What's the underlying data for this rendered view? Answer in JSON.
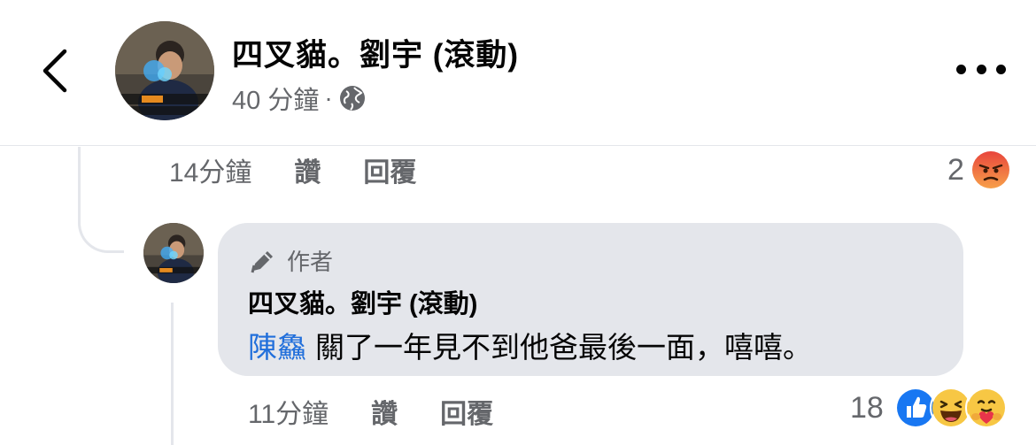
{
  "header": {
    "page_name": "四叉貓。劉宇 (滾動)",
    "time": "40 分鐘",
    "separator": "·",
    "privacy_icon": "globe-icon",
    "back_icon": "chevron-left-icon",
    "more_icon": "more-horizontal-icon"
  },
  "parent_comment": {
    "time": "14分鐘",
    "like_label": "讚",
    "reply_label": "回覆",
    "reaction_count": "2",
    "reactions": [
      "angry-emoji-icon"
    ]
  },
  "reply": {
    "badge_icon": "pencil-icon",
    "badge_label": "作者",
    "author": "四叉貓。劉宇 (滾動)",
    "mention": "陳鱻",
    "text": "關了一年見不到他爸最後一面，嘻嘻。",
    "time": "11分鐘",
    "like_label": "讚",
    "reply_label": "回覆",
    "reaction_count": "18",
    "reactions": [
      "like-emoji-icon",
      "haha-emoji-icon",
      "care-emoji-icon"
    ]
  },
  "colors": {
    "accent": "#216fdb",
    "bubble": "#e4e6eb",
    "secondary_text": "#65676b",
    "like_blue": "#1877f2",
    "angry_orange": "#f06b3c",
    "haha_yellow": "#f7c744"
  }
}
